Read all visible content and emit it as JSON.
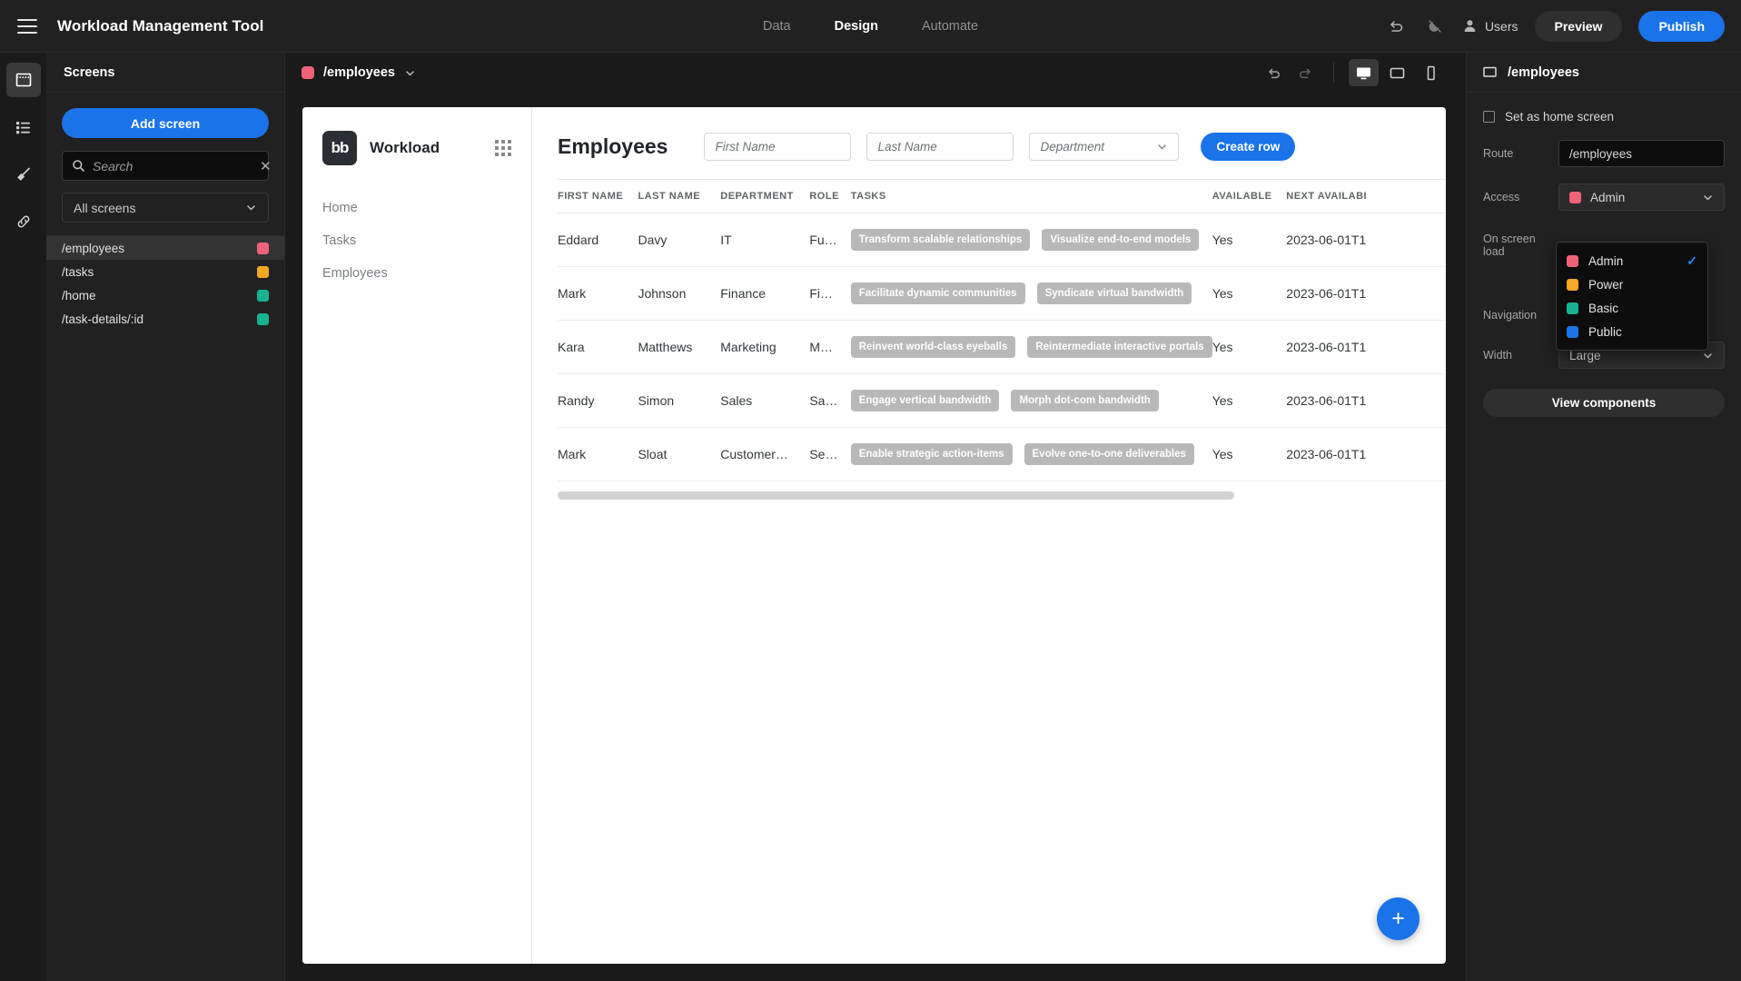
{
  "topbar": {
    "app_title": "Workload Management Tool",
    "menu_icon": "hamburger-icon",
    "tabs": [
      {
        "label": "Data",
        "active": false
      },
      {
        "label": "Design",
        "active": true
      },
      {
        "label": "Automate",
        "active": false
      }
    ],
    "undo_icon": "undo-icon",
    "theme_icon": "theme-off-icon",
    "users_label": "Users",
    "preview_label": "Preview",
    "publish_label": "Publish"
  },
  "rail": {
    "items": [
      {
        "name": "screens-icon",
        "active": true
      },
      {
        "name": "layers-icon",
        "active": false
      },
      {
        "name": "theme-brush-icon",
        "active": false
      },
      {
        "name": "links-icon",
        "active": false
      }
    ]
  },
  "screens_panel": {
    "title": "Screens",
    "add_button": "Add screen",
    "search_placeholder": "Search",
    "search_value": "",
    "filter_value": "All screens",
    "items": [
      {
        "route": "/employees",
        "color": "#f2617a",
        "selected": true
      },
      {
        "route": "/tasks",
        "color": "#f5a623",
        "selected": false
      },
      {
        "route": "/home",
        "color": "#16b390",
        "selected": false
      },
      {
        "route": "/task-details/:id",
        "color": "#16b390",
        "selected": false
      }
    ]
  },
  "canvas": {
    "breadcrumb_route": "/employees",
    "breadcrumb_color": "#f2617a",
    "undo_icon": "undo-arrow-icon",
    "redo_icon": "redo-arrow-icon",
    "devices": [
      {
        "name": "desktop-icon",
        "active": true
      },
      {
        "name": "tablet-icon",
        "active": false
      },
      {
        "name": "mobile-icon",
        "active": false
      }
    ]
  },
  "preview": {
    "brand": {
      "logo_text": "bb",
      "name": "Workload",
      "grid_icon": "grid-dots-icon"
    },
    "nav_links": [
      "Home",
      "Tasks",
      "Employees"
    ],
    "page_title": "Employees",
    "filters": {
      "first_name_placeholder": "First Name",
      "first_name_value": "",
      "last_name_placeholder": "Last Name",
      "last_name_value": "",
      "department_placeholder": "Department",
      "department_value": "",
      "create_row_label": "Create row"
    },
    "table": {
      "columns": [
        "FIRST NAME",
        "LAST NAME",
        "DEPARTMENT",
        "ROLE",
        "TASKS",
        "AVAILABLE",
        "NEXT AVAILABI"
      ],
      "rows": [
        {
          "first_name": "Eddard",
          "last_name": "Davy",
          "department": "IT",
          "role": "Fu…",
          "tasks": [
            "Transform scalable relationships",
            "Visualize end-to-end models"
          ],
          "available": "Yes",
          "next_available": "2023-06-01T1"
        },
        {
          "first_name": "Mark",
          "last_name": "Johnson",
          "department": "Finance",
          "role": "Fi…",
          "tasks": [
            "Facilitate dynamic communities",
            "Syndicate virtual bandwidth"
          ],
          "available": "Yes",
          "next_available": "2023-06-01T1"
        },
        {
          "first_name": "Kara",
          "last_name": "Matthews",
          "department": "Marketing",
          "role": "M…",
          "tasks": [
            "Reinvent world-class eyeballs",
            "Reintermediate interactive portals"
          ],
          "available": "Yes",
          "next_available": "2023-06-01T1"
        },
        {
          "first_name": "Randy",
          "last_name": "Simon",
          "department": "Sales",
          "role": "Sa…",
          "tasks": [
            "Engage vertical bandwidth",
            "Morph dot-com bandwidth"
          ],
          "available": "Yes",
          "next_available": "2023-06-01T1"
        },
        {
          "first_name": "Mark",
          "last_name": "Sloat",
          "department": "Customer…",
          "role": "Se…",
          "tasks": [
            "Enable strategic action-items",
            "Evolve one-to-one deliverables"
          ],
          "available": "Yes",
          "next_available": "2023-06-01T1"
        }
      ]
    },
    "fab_label": "+"
  },
  "right_panel": {
    "header_title": "/employees",
    "header_icon": "screen-icon",
    "home_checkbox_label": "Set as home screen",
    "home_checkbox_checked": false,
    "fields": {
      "route_label": "Route",
      "route_value": "/employees",
      "access_label": "Access",
      "access_value": "Admin",
      "access_color": "#f2617a",
      "on_screen_load_label": "On screen load",
      "navigation_label": "Navigation",
      "width_label": "Width",
      "width_value": "Large"
    },
    "view_components_label": "View components",
    "access_dropdown": {
      "open": true,
      "options": [
        {
          "label": "Admin",
          "color": "#f2617a",
          "checked": true
        },
        {
          "label": "Power",
          "color": "#f5a623",
          "checked": false
        },
        {
          "label": "Basic",
          "color": "#16b390",
          "checked": false
        },
        {
          "label": "Public",
          "color": "#1a73e8",
          "checked": false
        }
      ]
    }
  },
  "colors": {
    "accent_blue": "#1a73e8",
    "panel_bg": "#212121",
    "app_bg": "#1a1a1a",
    "tag_gray": "#b8b8b8"
  }
}
